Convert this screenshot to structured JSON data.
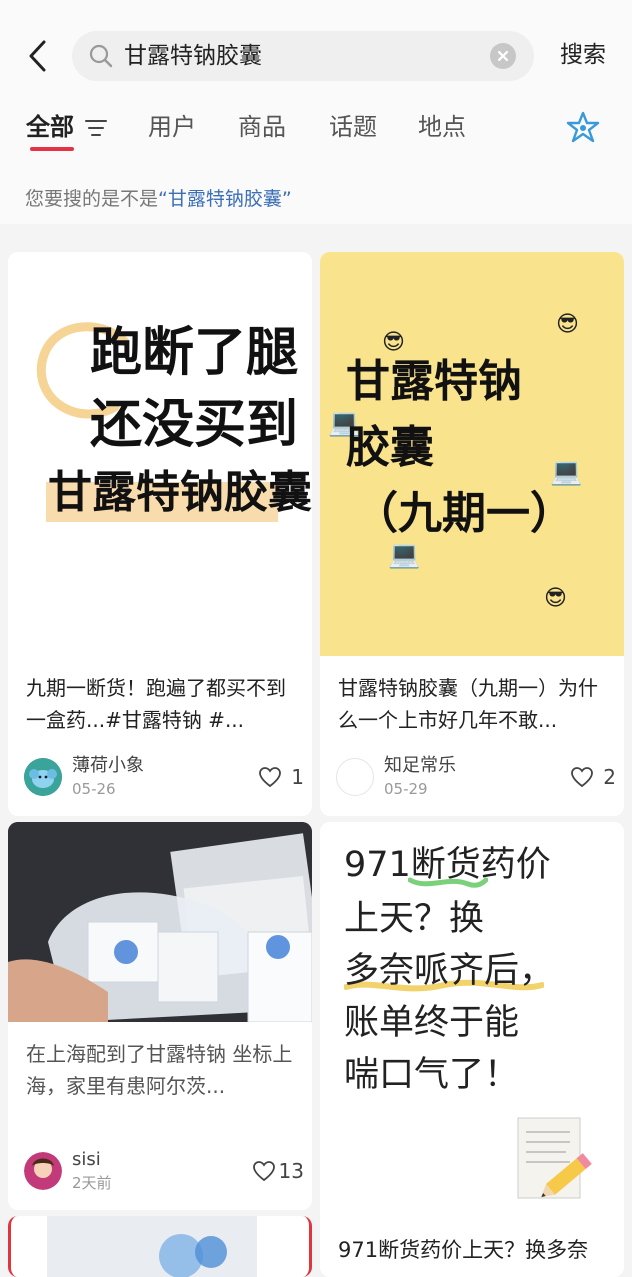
{
  "search": {
    "query": "甘露特钠胶囊",
    "button_label": "搜索"
  },
  "tabs": [
    {
      "label": "全部",
      "active": true
    },
    {
      "label": "用户"
    },
    {
      "label": "商品"
    },
    {
      "label": "话题"
    },
    {
      "label": "地点"
    }
  ],
  "suggestion": {
    "prefix": "您要搜的是不是",
    "keyword": "“甘露特钠胶囊”"
  },
  "colors": {
    "accent": "#e53346",
    "link": "#3b6fb6",
    "card2_bg": "#f9e38d"
  },
  "feed": [
    {
      "cover_lines": [
        "跑断了腿",
        "还没买到",
        "甘露特钠胶囊"
      ],
      "title": "九期一断货！跑遍了都买不到一盒药...#甘露特钠  #...",
      "author": "薄荷小象",
      "date": "05-26",
      "likes": "1"
    },
    {
      "cover_lines": [
        "甘露特钠",
        "胶囊",
        "（九期一）"
      ],
      "title": "甘露特钠胶囊（九期一）为什么一个上市好几年不敢...",
      "author": "知足常乐",
      "date": "05-29",
      "likes": "2"
    },
    {
      "title": "在上海配到了甘露特钠 坐标上海，家里有患阿尔茨...",
      "author": "sisi",
      "date": "2天前",
      "likes": "13"
    },
    {
      "cover_lines": [
        "971断货药价",
        "上天？换",
        "多奈哌齐后，",
        "账单终于能",
        "喘口气了！"
      ],
      "title": "971断货药价上天？换多奈"
    }
  ],
  "icons": [
    "back-icon",
    "search-icon",
    "clear-icon",
    "filter-icon",
    "ai-star-icon",
    "heart-icon",
    "pencil-emoji",
    "sunglasses-emoji",
    "laptop-emoji"
  ]
}
